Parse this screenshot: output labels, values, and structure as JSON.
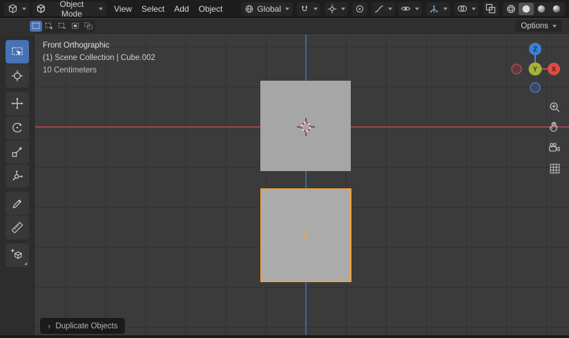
{
  "topbar": {
    "mode_label": "Object Mode",
    "menu_view": "View",
    "menu_select": "Select",
    "menu_add": "Add",
    "menu_object": "Object",
    "orientation_label": "Global"
  },
  "tool_settings": {
    "options_label": "Options"
  },
  "viewport": {
    "view_label": "Front Orthographic",
    "context_label": "(1) Scene Collection | Cube.002",
    "scale_label": "10 Centimeters"
  },
  "nav_gizmo": {
    "z_label": "Z",
    "y_label": "Y",
    "x_label": "X"
  },
  "operator_panel": {
    "chevron": "›",
    "label": "Duplicate Objects"
  },
  "toolbar_tools": [
    "select-box",
    "cursor",
    "move",
    "rotate",
    "scale",
    "transform",
    "annotate",
    "measure",
    "add-cube"
  ],
  "active_tool": "select-box",
  "select_modes": [
    "set",
    "extend",
    "subtract",
    "invert",
    "intersect"
  ],
  "active_select_mode": "set",
  "shading_modes": [
    "wireframe",
    "solid",
    "material-preview",
    "rendered"
  ],
  "active_shading_mode": "solid",
  "colors": {
    "active_tool_bg": "#4772b3",
    "selection_outline": "#f0a13a",
    "axis_x_line": "#9c444b",
    "axis_z_line": "#3e66a4",
    "origin_dot": "#ffa629"
  },
  "icons": {
    "editor_type": "3d-viewport-editor-icon",
    "mode_cube": "cube-icon",
    "orientation": "globe-icon",
    "snap": "magnet-icon",
    "snap_target": "snap-target-icon",
    "proportional": "proportional-edit-icon",
    "falloff": "falloff-curve-icon",
    "visibility": "eye-icon",
    "gizmos": "gizmo-icon",
    "overlays": "overlapping-circles-icon",
    "xray": "overlapping-squares-icon",
    "zoom": "magnifier-plus-icon",
    "pan": "hand-icon",
    "camera": "camera-icon",
    "view_toggle": "grid-icon",
    "cursor_3d": "crosshair-circle-icon",
    "operator_chevron": "chevron-right-icon"
  }
}
